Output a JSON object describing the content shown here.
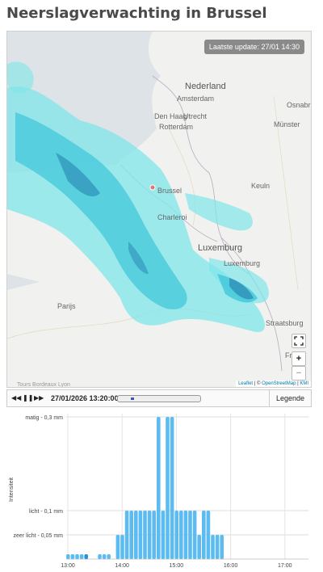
{
  "page": {
    "title": "Neerslagverwachting in Brussel"
  },
  "map": {
    "update_badge": "Laatste update: 27/01 14:30",
    "labels": {
      "nederland": "Nederland",
      "amsterdam": "Amsterdam",
      "den_haag": "Den Haag",
      "utrecht": "Utrecht",
      "rotterdam": "Rotterdam",
      "osnabruck": "Osnabrü",
      "munster": "Münster",
      "brussel": "Brussel",
      "koeln": "Keuln",
      "charleroi": "Charleroi",
      "luxembourg_region": "Luxemburg",
      "luxembourg_city": "Luxemburg",
      "parijs": "Parijs",
      "straatsburg": "Straatsburg",
      "freiburg": "Freib",
      "tours": "Tours Bordeaux Lyon"
    },
    "controls": {
      "fullscreen_icon": "fullscreen-icon",
      "zoom_in": "+",
      "zoom_out": "−"
    },
    "attribution": {
      "leaflet": "Leaflet",
      "sep1": " | © ",
      "osm": "OpenStreetMap",
      "sep2": " | ",
      "kmi": "KMI"
    },
    "colors": {
      "rain_light": "#7fe6ea",
      "rain_medium": "#41c7d9",
      "rain_strong": "#2e8fb8",
      "land": "#f1f1ef",
      "water": "#dde3e6"
    }
  },
  "player": {
    "rewind_icon": "rewind-icon",
    "pause_icon": "pause-icon",
    "forward_icon": "fast-forward-icon",
    "rewind": "◀◀",
    "pause": "❚❚",
    "forward": "▶▶",
    "timestamp": "27/01/2026 13:20:00",
    "progress_fraction": 0.1,
    "legend_label": "Legende"
  },
  "chart_data": {
    "type": "bar",
    "ylabel": "Intensiteit",
    "y_ticks": [
      {
        "value": 0.05,
        "label": "zeer licht - 0,05 mm"
      },
      {
        "value": 0.1,
        "label": "licht - 0,1 mm"
      },
      {
        "value": 0.3,
        "label": "matig - 0,3 mm"
      }
    ],
    "x_ticks": [
      "13:00",
      "14:00",
      "15:00",
      "16:00",
      "17:00"
    ],
    "bar_color": "#5cbcf2",
    "highlight_color": "#2f8fd8",
    "times": [
      "13:00",
      "13:05",
      "13:10",
      "13:15",
      "13:20",
      "13:25",
      "13:30",
      "13:35",
      "13:40",
      "13:45",
      "13:50",
      "13:55",
      "14:00",
      "14:05",
      "14:10",
      "14:15",
      "14:20",
      "14:25",
      "14:30",
      "14:35",
      "14:40",
      "14:45",
      "14:50",
      "14:55",
      "15:00",
      "15:05",
      "15:10",
      "15:15",
      "15:20",
      "15:25",
      "15:30",
      "15:35",
      "15:40",
      "15:45",
      "15:50",
      "15:55",
      "16:00",
      "16:05",
      "16:10",
      "16:15",
      "16:20",
      "16:25",
      "16:30",
      "16:35",
      "16:40",
      "16:45",
      "16:50",
      "16:55",
      "17:00",
      "17:05",
      "17:10",
      "17:15",
      "17:20",
      "17:25"
    ],
    "values": [
      0.01,
      0.01,
      0.01,
      0.01,
      0.01,
      0,
      0,
      0.01,
      0.01,
      0.01,
      0,
      0.05,
      0.05,
      0.1,
      0.1,
      0.1,
      0.1,
      0.1,
      0.1,
      0.1,
      0.3,
      0.1,
      0.3,
      0.3,
      0.1,
      0.1,
      0.1,
      0.1,
      0.1,
      0.05,
      0.1,
      0.1,
      0.05,
      0.05,
      0.05
    ],
    "current_index": 4
  }
}
